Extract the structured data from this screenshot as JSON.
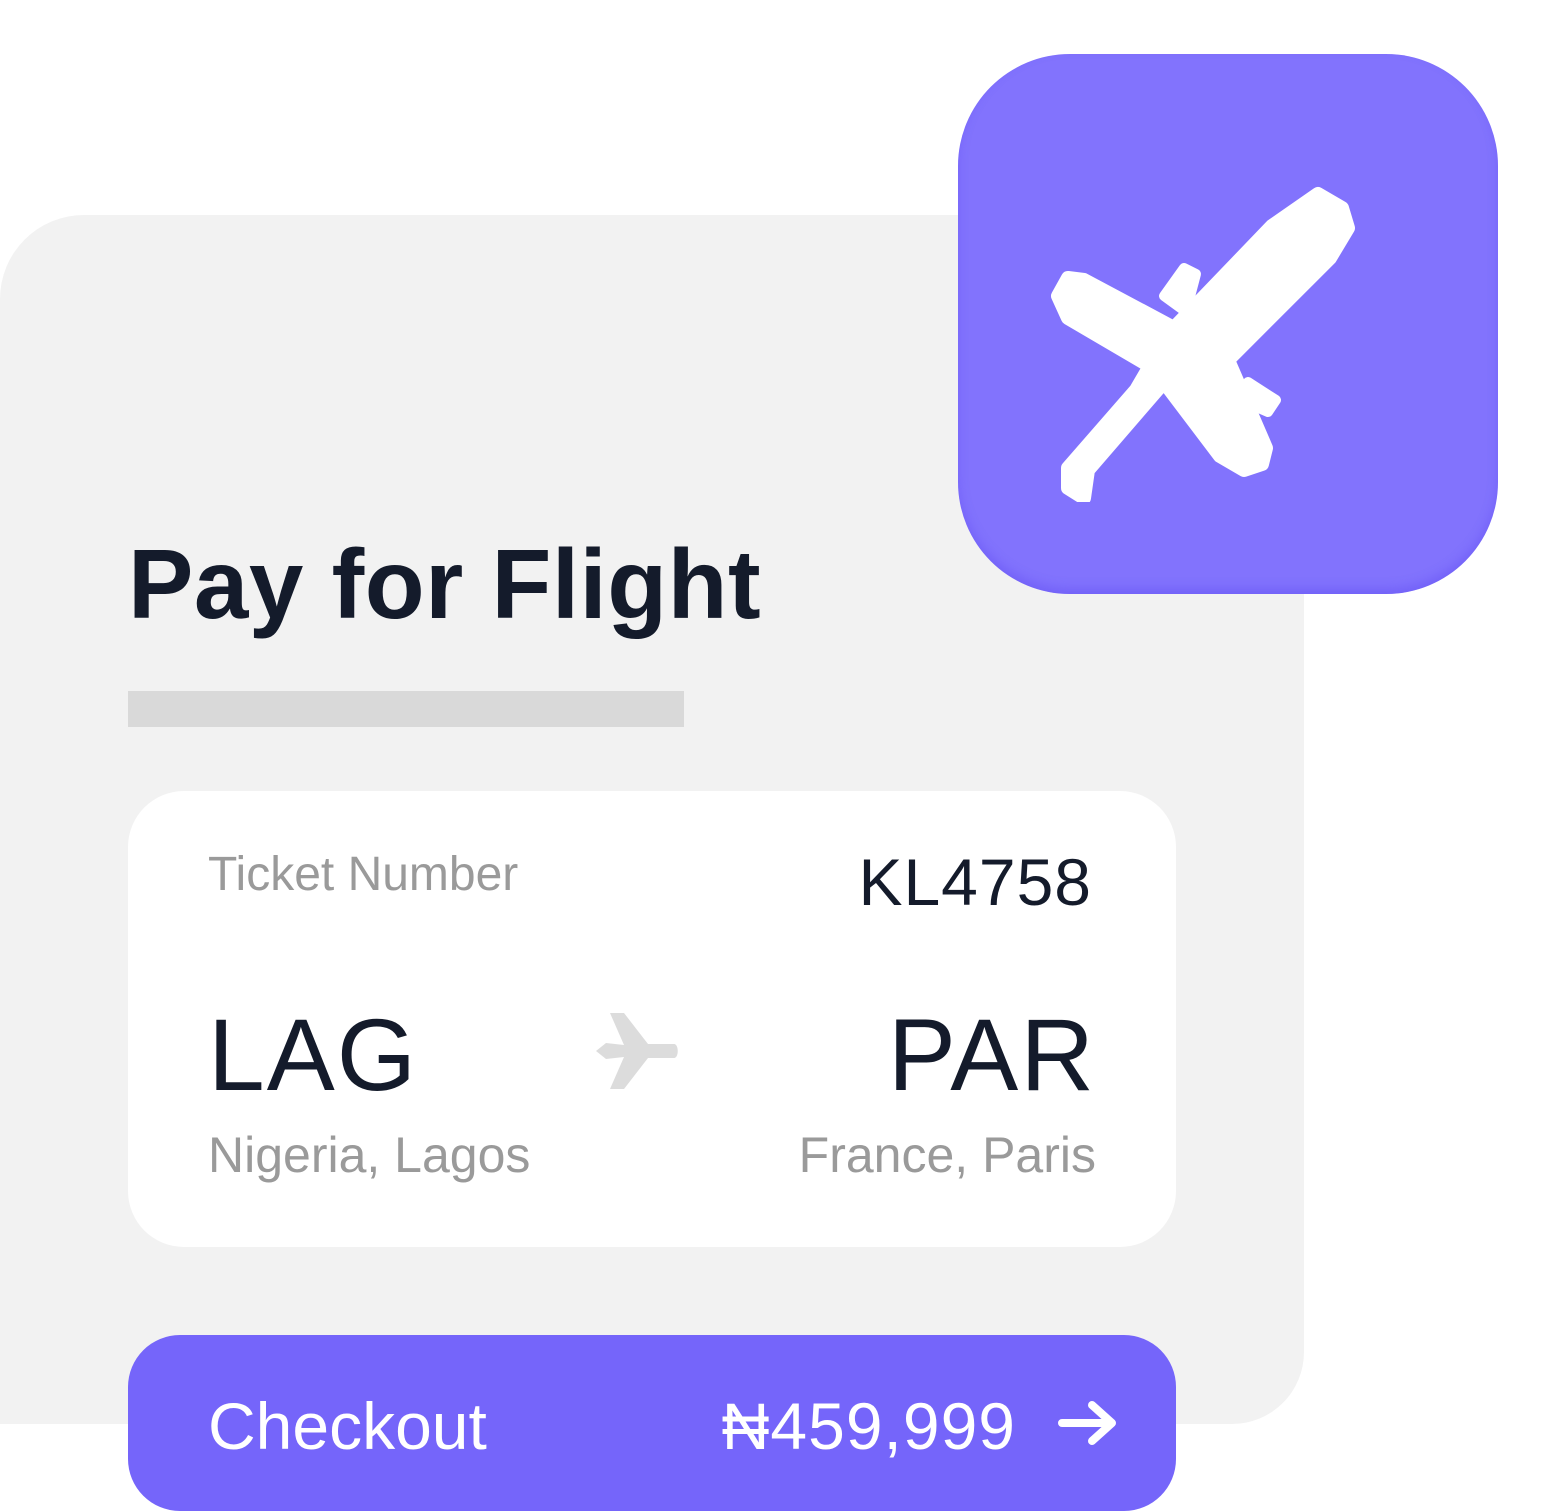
{
  "title": "Pay for Flight",
  "ticket": {
    "label": "Ticket Number",
    "number": "KL4758"
  },
  "route": {
    "from_code": "LAG",
    "from_city": "Nigeria, Lagos",
    "to_code": "PAR",
    "to_city": "France, Paris",
    "icon": "airplane-icon"
  },
  "checkout": {
    "label": "Checkout",
    "price": "₦459,999",
    "icon": "arrow-right-icon"
  },
  "app_icon": {
    "icon": "airplane-icon",
    "color": "#8273fd"
  },
  "colors": {
    "accent": "#7565fa",
    "title": "#141b2b",
    "muted": "#9a9a9a",
    "panel": "#f2f2f2"
  }
}
